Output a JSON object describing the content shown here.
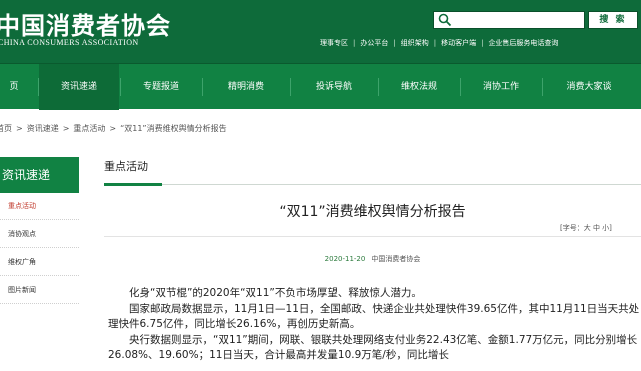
{
  "header": {
    "logo_title": "中国消费者协会",
    "logo_subtitle": "CHINA CONSUMERS ASSOCIATION",
    "search_button": "搜 索",
    "top_links": [
      "理事专区",
      "办公平台",
      "组织架构",
      "移动客户端",
      "企业售后服务电话查询"
    ]
  },
  "nav": {
    "items": [
      "页",
      "资讯速递",
      "专题报道",
      "精明消费",
      "投诉导航",
      "维权法规",
      "消协工作",
      "消费大家谈"
    ],
    "active_index": 1
  },
  "breadcrumb": [
    "首页",
    "资讯速递",
    "重点活动",
    "“双11”消费维权舆情分析报告"
  ],
  "sidebar": {
    "heading": "资讯速递",
    "items": [
      "重点活动",
      "消协观点",
      "维权广角",
      "图片新闻"
    ],
    "active_index": 0
  },
  "main": {
    "section_title": "重点活动",
    "article_title": "“双11”消费维权舆情分析报告",
    "font_size_control": "[字号：大 中 小]",
    "date": "2020-11-20",
    "source": "中国消费者协会",
    "paragraphs": [
      "化身“双节棍”的2020年“双11”不负市场厚望、释放惊人潜力。",
      "国家邮政局数据显示，11月1日—11日，全国邮政、快递企业共处理快件39.65亿件，其中11月11日当天共处理快件6.75亿件，同比增长26.16%，再创历史新高。",
      "央行数据则显示，“双11”期间，网联、银联共处理网络支付业务22.43亿笔、金额1.77万亿元，同比分别增长26.08%、19.60%；11日当天，合计最高并发量10.9万笔/秒，同比增长"
    ]
  },
  "colors": {
    "brand_green": "#0e6b3a",
    "nav_green": "#118243",
    "active_red": "#c0392b"
  }
}
